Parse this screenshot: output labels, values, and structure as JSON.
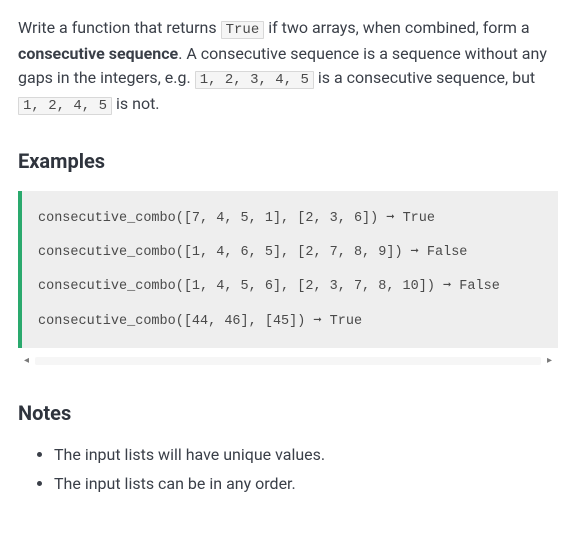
{
  "intro": {
    "part1": "Write a function that returns ",
    "code1": "True",
    "part2": " if two arrays, when combined, form a ",
    "bold": "consecutive sequence",
    "part3": ". A consecutive sequence is a sequence without any gaps in the integers, e.g. ",
    "code2": "1, 2, 3, 4, 5",
    "part4": " is a consecutive sequence, but ",
    "code3": "1, 2, 4, 5",
    "part5": " is not."
  },
  "examples_heading": "Examples",
  "code_lines": [
    "consecutive_combo([7, 4, 5, 1], [2, 3, 6]) ➞ True",
    "consecutive_combo([1, 4, 6, 5], [2, 7, 8, 9]) ➞ False",
    "consecutive_combo([1, 4, 5, 6], [2, 3, 7, 8, 10]) ➞ False",
    "consecutive_combo([44, 46], [45]) ➞ True"
  ],
  "notes_heading": "Notes",
  "notes": [
    "The input lists will have unique values.",
    "The input lists can be in any order."
  ],
  "scrollbar": {
    "left": "◂",
    "right": "▸"
  }
}
